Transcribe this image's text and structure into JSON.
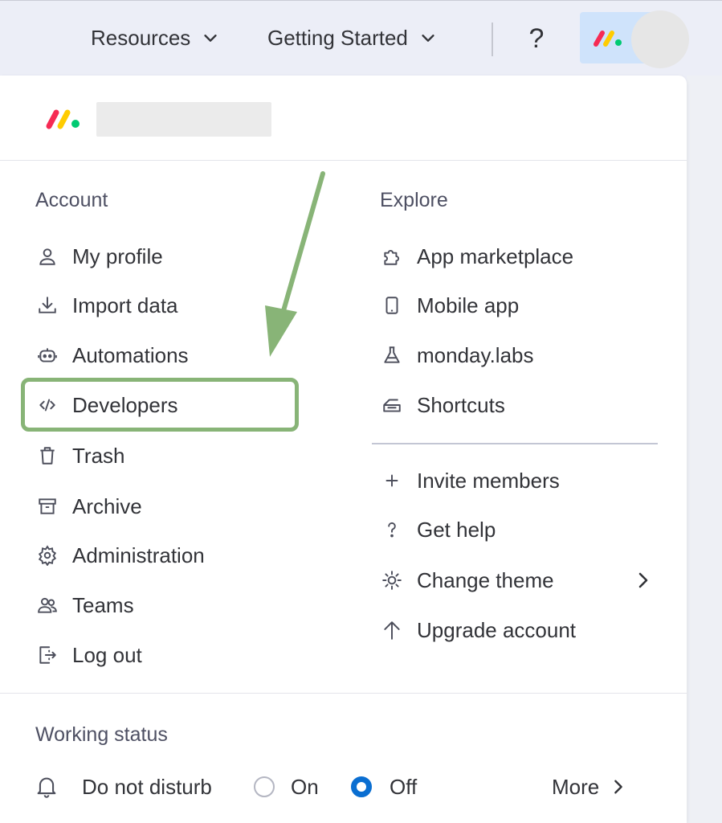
{
  "topbar": {
    "resources_label": "Resources",
    "getting_started_label": "Getting Started",
    "help_label": "?"
  },
  "account": {
    "title": "Account",
    "items": [
      {
        "label": "My profile",
        "icon": "person-icon"
      },
      {
        "label": "Import data",
        "icon": "download-icon"
      },
      {
        "label": "Automations",
        "icon": "robot-icon"
      },
      {
        "label": "Developers",
        "icon": "code-icon"
      },
      {
        "label": "Trash",
        "icon": "trash-icon"
      },
      {
        "label": "Archive",
        "icon": "archive-icon"
      },
      {
        "label": "Administration",
        "icon": "gear-icon"
      },
      {
        "label": "Teams",
        "icon": "teams-icon"
      },
      {
        "label": "Log out",
        "icon": "logout-icon"
      }
    ]
  },
  "explore": {
    "title": "Explore",
    "items": [
      {
        "label": "App marketplace",
        "icon": "puzzle-icon"
      },
      {
        "label": "Mobile app",
        "icon": "mobile-icon"
      },
      {
        "label": "monday.labs",
        "icon": "flask-icon"
      },
      {
        "label": "Shortcuts",
        "icon": "keyboard-icon"
      }
    ],
    "actions": [
      {
        "label": "Invite members",
        "icon": "plus-icon"
      },
      {
        "label": "Get help",
        "icon": "question-icon"
      },
      {
        "label": "Change theme",
        "icon": "sun-icon"
      },
      {
        "label": "Upgrade account",
        "icon": "arrow-up-icon"
      }
    ]
  },
  "working_status": {
    "title": "Working status",
    "dnd_label": "Do not disturb",
    "on_label": "On",
    "off_label": "Off",
    "selected": "Off",
    "more_label": "More"
  },
  "colors": {
    "accent_blue": "#0a6ed1",
    "annotation_green": "#88b477",
    "logo_red": "#f62b54",
    "logo_yellow": "#ffcc00",
    "logo_green": "#00ca72"
  }
}
